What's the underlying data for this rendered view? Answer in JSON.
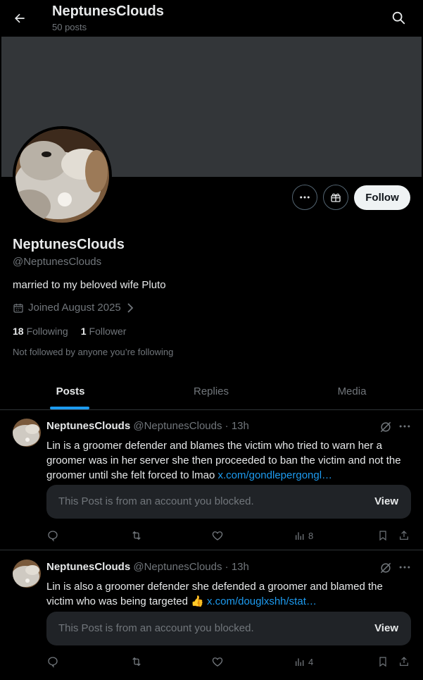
{
  "header": {
    "title": "NeptunesClouds",
    "posts_count": "50 posts"
  },
  "profile": {
    "name": "NeptunesClouds",
    "handle": "@NeptunesClouds",
    "bio": "married to my beloved wife Pluto",
    "joined": "Joined August 2025",
    "following_count": "18",
    "following_label": "Following",
    "followers_count": "1",
    "followers_label": "Follower",
    "not_followed": "Not followed by anyone you’re following",
    "follow_label": "Follow"
  },
  "tabs": [
    {
      "label": "Posts"
    },
    {
      "label": "Replies"
    },
    {
      "label": "Media"
    }
  ],
  "posts": [
    {
      "name": "NeptunesClouds",
      "handle": "@NeptunesClouds",
      "time": "· 13h",
      "text": "Lin is a groomer defender and blames the victim who tried to warn her a groomer was in her server she then proceeded to ban the victim and not the groomer until she felt forced to lmao ",
      "link": "x.com/gondlepergongl…",
      "blocked_text": "This Post is from an account you blocked.",
      "view_label": "View",
      "views": "8"
    },
    {
      "name": "NeptunesClouds",
      "handle": "@NeptunesClouds",
      "time": "· 13h",
      "text": "Lin is also a groomer defender she defended a groomer and blamed the victim who was being targeted 👍 ",
      "link": "x.com/douglxshh/stat…",
      "blocked_text": "This Post is from an account you blocked.",
      "view_label": "View",
      "views": "4"
    }
  ],
  "colors": {
    "accent": "#1d9bf0",
    "background": "#000000",
    "banner": "#333639",
    "muted_text": "#71767b",
    "text": "#e7e9ea"
  },
  "icons": [
    "back-arrow-icon",
    "search-icon",
    "more-icon",
    "subscribe-gift-icon",
    "calendar-icon",
    "chevron-right-icon",
    "grok-icon",
    "reply-icon",
    "repost-icon",
    "like-icon",
    "views-icon",
    "bookmark-icon",
    "share-icon"
  ]
}
